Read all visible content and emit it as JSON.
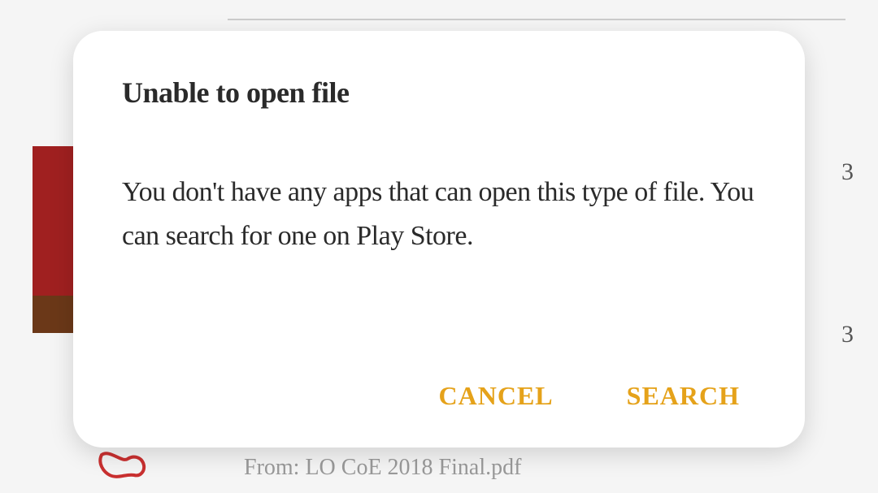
{
  "background": {
    "peek_char_1": "3",
    "peek_char_2": "3",
    "from_text": "From: LO CoE 2018 Final.pdf"
  },
  "dialog": {
    "title": "Unable to open file",
    "message": "You don't have any apps that can open this type of file. You can search for one on Play Store.",
    "cancel_label": "CANCEL",
    "search_label": "SEARCH"
  }
}
